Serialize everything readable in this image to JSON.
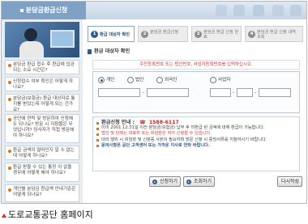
{
  "header": {
    "title": "분담금환급신청"
  },
  "sidebar": {
    "faqs": [
      {
        "text": "분담금 환급 접수 후 환급에 입금되는 소요 시간은?"
      },
      {
        "text": "신청접수 여부 확인은 어떻게 하나요?"
      },
      {
        "text": "분담금(보험금) 환급 대상자로 통지를 받았는데 어떻게 되는 건가요?"
      },
      {
        "text": "공단에 연락 및 방문하여 신청해도 되나요? 방문 시 지참물은 무엇입니까? 당사자가 직접 방문해야 하나요?"
      },
      {
        "text": "환급 금액이 얼마인지 알 수 없는데 어떻게 하나요?"
      },
      {
        "text": "환급 받을 수 있는 통장 이 없을 경우에 어떻게 해야 하나요?"
      },
      {
        "text": "개인별 분담금 환급액 안내기준은 어떻게 되나요?"
      }
    ]
  },
  "steps": [
    {
      "num": "1",
      "label": "환급 대상자 확인"
    },
    {
      "num": "2",
      "label": "분담금 환급신청"
    },
    {
      "num": "3",
      "label": "분담금 환급 신청 완료"
    },
    {
      "num": "4",
      "label": "분담금 환급 신청 내역 조회"
    }
  ],
  "section": {
    "title": "환급 대상자 확인"
  },
  "notice": {
    "text": "주민등록번호 또는 법인번호, 사업자등록번호를 입력하십시오."
  },
  "form": {
    "radios": [
      {
        "label": "개인",
        "checked": true
      },
      {
        "label": "법인",
        "checked": false
      },
      {
        "label": "외국인",
        "checked": false
      },
      {
        "label": "사업자",
        "checked": false
      }
    ]
  },
  "info": {
    "phone_label": "환급신청 안내 :",
    "phone": "1588-6117",
    "lines": [
      "이미 2001.12.31일 이전 분담금(보험금) 납부 후 미환급 된 금액에 대해 환급이 가능합니다.",
      "법인 및 단체는 대표자 또는 위임받은 자가 신청할 수 있습니다.",
      "대리 행위 시 위임장 및 신분증 사본이 필요하며 방문 신청 시 증빙서류를 지참하시기 바랍니다.",
      "문의사항은 공단 고객센터 또는 가까운 지사로 연락 바랍니다."
    ]
  },
  "buttons": {
    "apply": "신청하기",
    "inquiry": "조회하기",
    "rewrite": "다시작성"
  },
  "caption": {
    "text": "도로교통공단 홈페이지"
  }
}
